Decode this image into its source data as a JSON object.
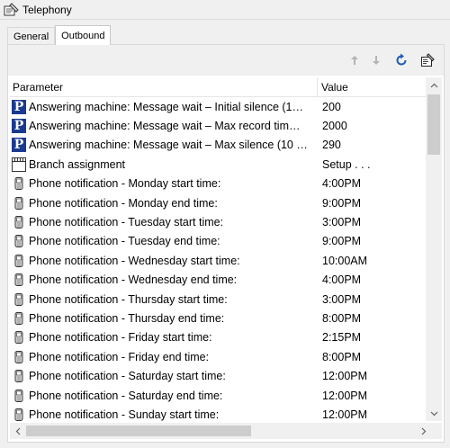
{
  "window": {
    "title": "Telephony",
    "title_icon": "telephony-settings-icon"
  },
  "tabs": [
    {
      "label": "General",
      "active": false
    },
    {
      "label": "Outbound",
      "active": true
    }
  ],
  "toolbar": {
    "move_up_icon": "arrow-up-icon",
    "move_down_icon": "arrow-down-icon",
    "refresh_icon": "refresh-icon",
    "properties_icon": "properties-icon"
  },
  "grid": {
    "columns": {
      "parameter": "Parameter",
      "value": "Value"
    },
    "rows": [
      {
        "icon": "p",
        "parameter": "Answering machine: Message wait – Initial silence (1…",
        "value": "200"
      },
      {
        "icon": "p",
        "parameter": "Answering machine: Message wait – Max record tim…",
        "value": "2000"
      },
      {
        "icon": "p",
        "parameter": "Answering machine: Message wait – Max silence (10 …",
        "value": "290"
      },
      {
        "icon": "board",
        "parameter": "Branch assignment",
        "value": "Setup . . ."
      },
      {
        "icon": "phone",
        "parameter": "Phone notification - Monday start time:",
        "value": "4:00PM"
      },
      {
        "icon": "phone",
        "parameter": "Phone notification - Monday end time:",
        "value": "9:00PM"
      },
      {
        "icon": "phone",
        "parameter": "Phone notification - Tuesday start time:",
        "value": "3:00PM"
      },
      {
        "icon": "phone",
        "parameter": "Phone notification - Tuesday end time:",
        "value": "9:00PM"
      },
      {
        "icon": "phone",
        "parameter": "Phone notification - Wednesday start time:",
        "value": "10:00AM"
      },
      {
        "icon": "phone",
        "parameter": "Phone notification - Wednesday end time:",
        "value": "4:00PM"
      },
      {
        "icon": "phone",
        "parameter": "Phone notification - Thursday start time:",
        "value": "3:00PM"
      },
      {
        "icon": "phone",
        "parameter": "Phone notification - Thursday end time:",
        "value": "8:00PM"
      },
      {
        "icon": "phone",
        "parameter": "Phone notification - Friday start time:",
        "value": "2:15PM"
      },
      {
        "icon": "phone",
        "parameter": "Phone notification - Friday end time:",
        "value": "8:00PM"
      },
      {
        "icon": "phone",
        "parameter": "Phone notification - Saturday start time:",
        "value": "12:00PM"
      },
      {
        "icon": "phone",
        "parameter": "Phone notification - Saturday end time:",
        "value": "12:00PM"
      },
      {
        "icon": "phone",
        "parameter": "Phone notification - Sunday start time:",
        "value": "12:00PM"
      }
    ]
  },
  "colors": {
    "accent_blue": "#1a3a8f",
    "refresh_blue": "#1e5bb8"
  }
}
